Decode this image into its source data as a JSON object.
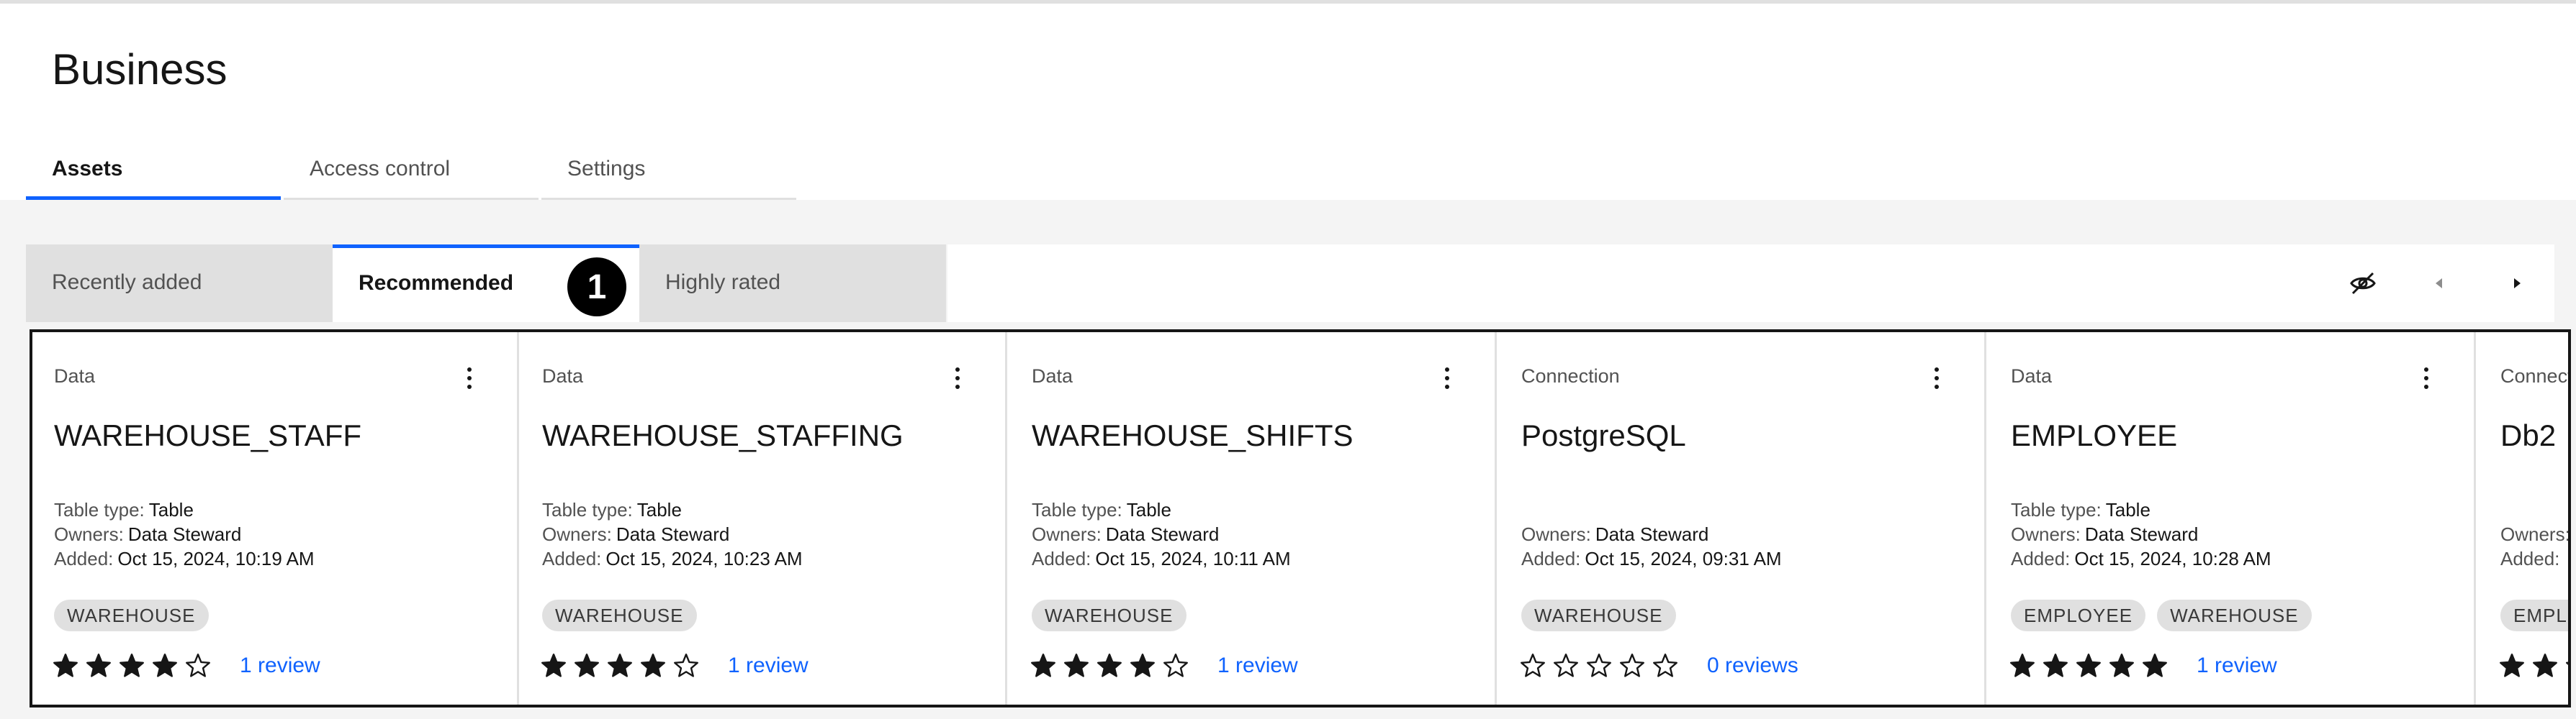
{
  "page": {
    "title": "Business",
    "tabs": [
      {
        "label": "Assets",
        "active": true
      },
      {
        "label": "Access control",
        "active": false
      },
      {
        "label": "Settings",
        "active": false
      }
    ]
  },
  "carousel": {
    "subtabs": [
      {
        "label": "Recently added",
        "active": false
      },
      {
        "label": "Recommended",
        "active": true
      },
      {
        "label": "Highly rated",
        "active": false
      }
    ],
    "badge": "1",
    "toolbar_icons": [
      "hide-icon",
      "previous-icon",
      "next-icon"
    ]
  },
  "cards": [
    {
      "type": "Data",
      "name": "WAREHOUSE_STAFF",
      "table_type_label": "Table type:",
      "table_type": "Table",
      "owners_label": "Owners:",
      "owners": "Data Steward",
      "added_label": "Added:",
      "added": "Oct 15, 2024, 10:19 AM",
      "tags": [
        "WAREHOUSE"
      ],
      "rating": 4,
      "reviews": "1 review"
    },
    {
      "type": "Data",
      "name": "WAREHOUSE_STAFFING",
      "table_type_label": "Table type:",
      "table_type": "Table",
      "owners_label": "Owners:",
      "owners": "Data Steward",
      "added_label": "Added:",
      "added": "Oct 15, 2024, 10:23 AM",
      "tags": [
        "WAREHOUSE"
      ],
      "rating": 4,
      "reviews": "1 review"
    },
    {
      "type": "Data",
      "name": "WAREHOUSE_SHIFTS",
      "table_type_label": "Table type:",
      "table_type": "Table",
      "owners_label": "Owners:",
      "owners": "Data Steward",
      "added_label": "Added:",
      "added": "Oct 15, 2024, 10:11 AM",
      "tags": [
        "WAREHOUSE"
      ],
      "rating": 4,
      "reviews": "1 review"
    },
    {
      "type": "Connection",
      "name": "PostgreSQL",
      "owners_label": "Owners:",
      "owners": "Data Steward",
      "added_label": "Added:",
      "added": "Oct 15, 2024, 09:31 AM",
      "tags": [
        "WAREHOUSE"
      ],
      "rating": 0,
      "reviews": "0 reviews"
    },
    {
      "type": "Data",
      "name": "EMPLOYEE",
      "table_type_label": "Table type:",
      "table_type": "Table",
      "owners_label": "Owners:",
      "owners": "Data Steward",
      "added_label": "Added:",
      "added": "Oct 15, 2024, 10:28 AM",
      "tags": [
        "EMPLOYEE",
        "WAREHOUSE"
      ],
      "rating": 5,
      "reviews": "1 review"
    },
    {
      "type": "Connection",
      "name": "Db2",
      "owners_label": "Owners:",
      "owners": "",
      "added_label": "Added:",
      "added": "",
      "tags": [
        "EMPLOYEE"
      ],
      "rating": 2,
      "reviews": ""
    }
  ],
  "colors": {
    "accent": "#0f62fe",
    "panel": "#f4f4f4",
    "tab_inactive": "#e0e0e0"
  }
}
